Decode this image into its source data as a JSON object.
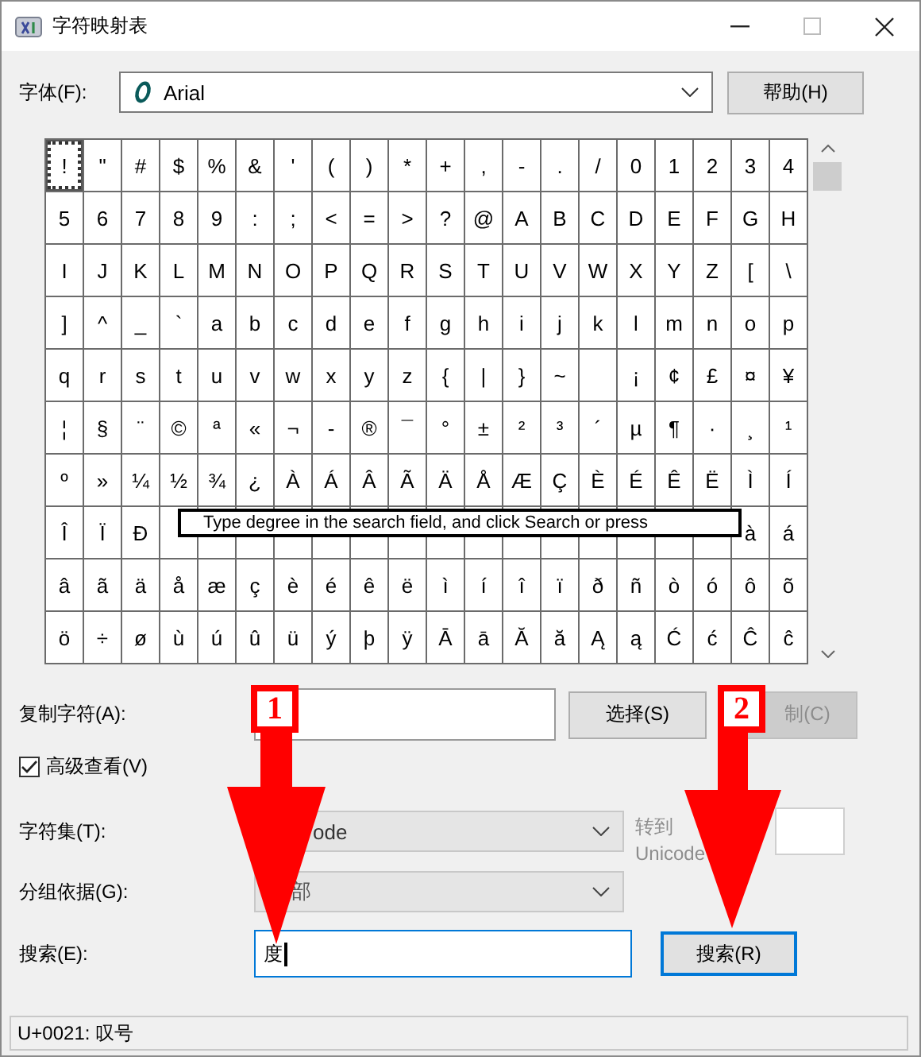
{
  "window": {
    "title": "字符映射表"
  },
  "font": {
    "label": "字体(F):",
    "value": "Arial"
  },
  "help_button": "帮助(H)",
  "grid": {
    "rows": [
      [
        {
          "ch": "!",
          "selected": true
        },
        {
          "ch": "\"",
          "selected": false
        },
        {
          "ch": "#",
          "selected": false
        },
        {
          "ch": "$",
          "selected": false
        },
        {
          "ch": "%",
          "selected": false
        },
        {
          "ch": "&",
          "selected": false
        },
        {
          "ch": "'",
          "selected": false
        },
        {
          "ch": "(",
          "selected": false
        },
        {
          "ch": ")",
          "selected": false
        },
        {
          "ch": "*",
          "selected": false
        },
        {
          "ch": "+",
          "selected": false
        },
        {
          "ch": ",",
          "selected": false
        },
        {
          "ch": "-",
          "selected": false
        },
        {
          "ch": ".",
          "selected": false
        },
        {
          "ch": "/",
          "selected": false
        },
        {
          "ch": "0",
          "selected": false
        },
        {
          "ch": "1",
          "selected": false
        },
        {
          "ch": "2",
          "selected": false
        },
        {
          "ch": "3",
          "selected": false
        },
        {
          "ch": "4",
          "selected": false
        }
      ],
      [
        {
          "ch": "5",
          "selected": false
        },
        {
          "ch": "6",
          "selected": false
        },
        {
          "ch": "7",
          "selected": false
        },
        {
          "ch": "8",
          "selected": false
        },
        {
          "ch": "9",
          "selected": false
        },
        {
          "ch": ":",
          "selected": false
        },
        {
          "ch": ";",
          "selected": false
        },
        {
          "ch": "<",
          "selected": false
        },
        {
          "ch": "=",
          "selected": false
        },
        {
          "ch": ">",
          "selected": false
        },
        {
          "ch": "?",
          "selected": false
        },
        {
          "ch": "@",
          "selected": false
        },
        {
          "ch": "A",
          "selected": false
        },
        {
          "ch": "B",
          "selected": false
        },
        {
          "ch": "C",
          "selected": false
        },
        {
          "ch": "D",
          "selected": false
        },
        {
          "ch": "E",
          "selected": false
        },
        {
          "ch": "F",
          "selected": false
        },
        {
          "ch": "G",
          "selected": false
        },
        {
          "ch": "H",
          "selected": false
        }
      ],
      [
        {
          "ch": "I",
          "selected": false
        },
        {
          "ch": "J",
          "selected": false
        },
        {
          "ch": "K",
          "selected": false
        },
        {
          "ch": "L",
          "selected": false
        },
        {
          "ch": "M",
          "selected": false
        },
        {
          "ch": "N",
          "selected": false
        },
        {
          "ch": "O",
          "selected": false
        },
        {
          "ch": "P",
          "selected": false
        },
        {
          "ch": "Q",
          "selected": false
        },
        {
          "ch": "R",
          "selected": false
        },
        {
          "ch": "S",
          "selected": false
        },
        {
          "ch": "T",
          "selected": false
        },
        {
          "ch": "U",
          "selected": false
        },
        {
          "ch": "V",
          "selected": false
        },
        {
          "ch": "W",
          "selected": false
        },
        {
          "ch": "X",
          "selected": false
        },
        {
          "ch": "Y",
          "selected": false
        },
        {
          "ch": "Z",
          "selected": false
        },
        {
          "ch": "[",
          "selected": false
        },
        {
          "ch": "\\",
          "selected": false
        }
      ],
      [
        {
          "ch": "]",
          "selected": false
        },
        {
          "ch": "^",
          "selected": false
        },
        {
          "ch": "_",
          "selected": false
        },
        {
          "ch": "`",
          "selected": false
        },
        {
          "ch": "a",
          "selected": false
        },
        {
          "ch": "b",
          "selected": false
        },
        {
          "ch": "c",
          "selected": false
        },
        {
          "ch": "d",
          "selected": false
        },
        {
          "ch": "e",
          "selected": false
        },
        {
          "ch": "f",
          "selected": false
        },
        {
          "ch": "g",
          "selected": false
        },
        {
          "ch": "h",
          "selected": false
        },
        {
          "ch": "i",
          "selected": false
        },
        {
          "ch": "j",
          "selected": false
        },
        {
          "ch": "k",
          "selected": false
        },
        {
          "ch": "l",
          "selected": false
        },
        {
          "ch": "m",
          "selected": false
        },
        {
          "ch": "n",
          "selected": false
        },
        {
          "ch": "o",
          "selected": false
        },
        {
          "ch": "p",
          "selected": false
        }
      ],
      [
        {
          "ch": "q",
          "selected": false
        },
        {
          "ch": "r",
          "selected": false
        },
        {
          "ch": "s",
          "selected": false
        },
        {
          "ch": "t",
          "selected": false
        },
        {
          "ch": "u",
          "selected": false
        },
        {
          "ch": "v",
          "selected": false
        },
        {
          "ch": "w",
          "selected": false
        },
        {
          "ch": "x",
          "selected": false
        },
        {
          "ch": "y",
          "selected": false
        },
        {
          "ch": "z",
          "selected": false
        },
        {
          "ch": "{",
          "selected": false
        },
        {
          "ch": "|",
          "selected": false
        },
        {
          "ch": "}",
          "selected": false
        },
        {
          "ch": "~",
          "selected": false
        },
        {
          "selected": false
        },
        {
          "ch": "¡",
          "selected": false
        },
        {
          "ch": "¢",
          "selected": false
        },
        {
          "ch": "£",
          "selected": false
        },
        {
          "ch": "¤",
          "selected": false
        },
        {
          "ch": "¥",
          "selected": false
        }
      ],
      [
        {
          "ch": "¦",
          "selected": false
        },
        {
          "ch": "§",
          "selected": false
        },
        {
          "ch": "¨",
          "selected": false
        },
        {
          "ch": "©",
          "selected": false
        },
        {
          "ch": "ª",
          "selected": false
        },
        {
          "ch": "«",
          "selected": false
        },
        {
          "ch": "¬",
          "selected": false
        },
        {
          "ch": "-",
          "selected": false
        },
        {
          "ch": "®",
          "selected": false
        },
        {
          "ch": "¯",
          "selected": false
        },
        {
          "ch": "°",
          "selected": false
        },
        {
          "ch": "±",
          "selected": false
        },
        {
          "ch": "²",
          "selected": false
        },
        {
          "ch": "³",
          "selected": false
        },
        {
          "ch": "´",
          "selected": false
        },
        {
          "ch": "µ",
          "selected": false
        },
        {
          "ch": "¶",
          "selected": false
        },
        {
          "ch": "·",
          "selected": false
        },
        {
          "ch": "¸",
          "selected": false
        },
        {
          "ch": "¹",
          "selected": false
        }
      ],
      [
        {
          "ch": "º",
          "selected": false
        },
        {
          "ch": "»",
          "selected": false
        },
        {
          "ch": "¼",
          "selected": false
        },
        {
          "ch": "½",
          "selected": false
        },
        {
          "ch": "¾",
          "selected": false
        },
        {
          "ch": "¿",
          "selected": false
        },
        {
          "ch": "À",
          "selected": false
        },
        {
          "ch": "Á",
          "selected": false
        },
        {
          "ch": "Â",
          "selected": false
        },
        {
          "ch": "Ã",
          "selected": false
        },
        {
          "ch": "Ä",
          "selected": false
        },
        {
          "ch": "Å",
          "selected": false
        },
        {
          "ch": "Æ",
          "selected": false
        },
        {
          "ch": "Ç",
          "selected": false
        },
        {
          "ch": "È",
          "selected": false
        },
        {
          "ch": "É",
          "selected": false
        },
        {
          "ch": "Ê",
          "selected": false
        },
        {
          "ch": "Ë",
          "selected": false
        },
        {
          "ch": "Ì",
          "selected": false
        },
        {
          "ch": "Í",
          "selected": false
        }
      ],
      [
        {
          "ch": "Î",
          "selected": false
        },
        {
          "ch": "Ï",
          "selected": false
        },
        {
          "ch": "Ð",
          "selected": false
        },
        {
          "selected": false
        },
        {
          "selected": false
        },
        {
          "selected": false
        },
        {
          "selected": false
        },
        {
          "selected": false
        },
        {
          "selected": false
        },
        {
          "selected": false
        },
        {
          "selected": false
        },
        {
          "selected": false
        },
        {
          "selected": false
        },
        {
          "selected": false
        },
        {
          "selected": false
        },
        {
          "selected": false
        },
        {
          "selected": false
        },
        {
          "selected": false
        },
        {
          "ch": "à",
          "selected": false
        },
        {
          "ch": "á",
          "selected": false
        }
      ],
      [
        {
          "ch": "â",
          "selected": false
        },
        {
          "ch": "ã",
          "selected": false
        },
        {
          "ch": "ä",
          "selected": false
        },
        {
          "ch": "å",
          "selected": false
        },
        {
          "ch": "æ",
          "selected": false
        },
        {
          "ch": "ç",
          "selected": false
        },
        {
          "ch": "è",
          "selected": false
        },
        {
          "ch": "é",
          "selected": false
        },
        {
          "ch": "ê",
          "selected": false
        },
        {
          "ch": "ë",
          "selected": false
        },
        {
          "ch": "ì",
          "selected": false
        },
        {
          "ch": "í",
          "selected": false
        },
        {
          "ch": "î",
          "selected": false
        },
        {
          "ch": "ï",
          "selected": false
        },
        {
          "ch": "ð",
          "selected": false
        },
        {
          "ch": "ñ",
          "selected": false
        },
        {
          "ch": "ò",
          "selected": false
        },
        {
          "ch": "ó",
          "selected": false
        },
        {
          "ch": "ô",
          "selected": false
        },
        {
          "ch": "õ",
          "selected": false
        }
      ],
      [
        {
          "ch": "ö",
          "selected": false
        },
        {
          "ch": "÷",
          "selected": false
        },
        {
          "ch": "ø",
          "selected": false
        },
        {
          "ch": "ù",
          "selected": false
        },
        {
          "ch": "ú",
          "selected": false
        },
        {
          "ch": "û",
          "selected": false
        },
        {
          "ch": "ü",
          "selected": false
        },
        {
          "ch": "ý",
          "selected": false
        },
        {
          "ch": "þ",
          "selected": false
        },
        {
          "ch": "ÿ",
          "selected": false
        },
        {
          "ch": "Ā",
          "selected": false
        },
        {
          "ch": "ā",
          "selected": false
        },
        {
          "ch": "Ă",
          "selected": false
        },
        {
          "ch": "ă",
          "selected": false
        },
        {
          "ch": "Ą",
          "selected": false
        },
        {
          "ch": "ą",
          "selected": false
        },
        {
          "ch": "Ć",
          "selected": false
        },
        {
          "ch": "ć",
          "selected": false
        },
        {
          "ch": "Ĉ",
          "selected": false
        },
        {
          "ch": "ĉ",
          "selected": false
        }
      ]
    ]
  },
  "tooltip": "Type degree in the search field, and click Search or press",
  "copy": {
    "label": "复制字符(A):",
    "select_button": "选择(S)",
    "copy_button": {
      "label": "制(C)",
      "disabled": true
    }
  },
  "advanced_view": {
    "label": "高级查看(V)",
    "checked": true
  },
  "charset": {
    "label": "字符集(T):",
    "value": "ode",
    "disabled": true
  },
  "goto_unicode": {
    "label_lines": [
      "转到",
      "Unicode"
    ],
    "disabled": true
  },
  "group_by": {
    "label": "分组依据(G):",
    "value": "部",
    "disabled": true
  },
  "search": {
    "label": "搜索(E):",
    "value": "度",
    "button": "搜索(R)"
  },
  "status_bar": "U+0021: 叹号",
  "annotations": [
    {
      "number": "1"
    },
    {
      "number": "2"
    }
  ]
}
